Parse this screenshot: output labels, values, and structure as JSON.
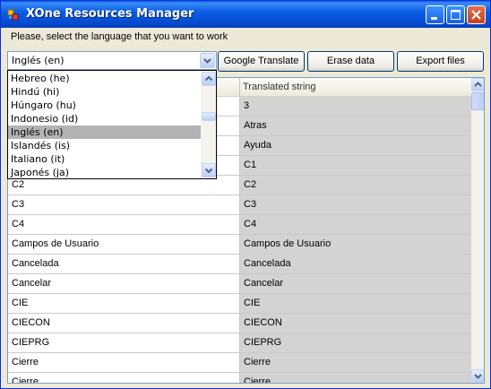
{
  "window": {
    "title": "XOne Resources Manager",
    "accent_color": "#0a5ee6",
    "controls": {
      "minimize": "minimize-icon",
      "maximize": "maximize-icon",
      "close": "close-icon"
    }
  },
  "prompt": "Please, select the language that you want to work",
  "language_select": {
    "value": "Inglés (en)",
    "options": [
      "Hebreo (he)",
      "Hindú (hi)",
      "Húngaro (hu)",
      "Indonesio (id)",
      "Inglés (en)",
      "Islandés (is)",
      "Italiano (it)",
      "Japonés (ja)"
    ],
    "selected_index": 4
  },
  "buttons": {
    "google_translate": "Google Translate",
    "erase_data": "Erase data",
    "export_files": "Export files"
  },
  "grid": {
    "columns": [
      "",
      "Translated string"
    ],
    "rows": [
      [
        "",
        "3"
      ],
      [
        "",
        "Atras"
      ],
      [
        "",
        "Ayuda"
      ],
      [
        "",
        "C1"
      ],
      [
        "C2",
        "C2"
      ],
      [
        "C3",
        "C3"
      ],
      [
        "C4",
        "C4"
      ],
      [
        "Campos de Usuario",
        "Campos de Usuario"
      ],
      [
        "Cancelada",
        "Cancelada"
      ],
      [
        "Cancelar",
        "Cancelar"
      ],
      [
        "CIE",
        "CIE"
      ],
      [
        "CIECON",
        "CIECON"
      ],
      [
        "CIEPRG",
        "CIEPRG"
      ],
      [
        "Cierre",
        "Cierre"
      ],
      [
        "Cierre",
        "Cierre"
      ]
    ]
  }
}
